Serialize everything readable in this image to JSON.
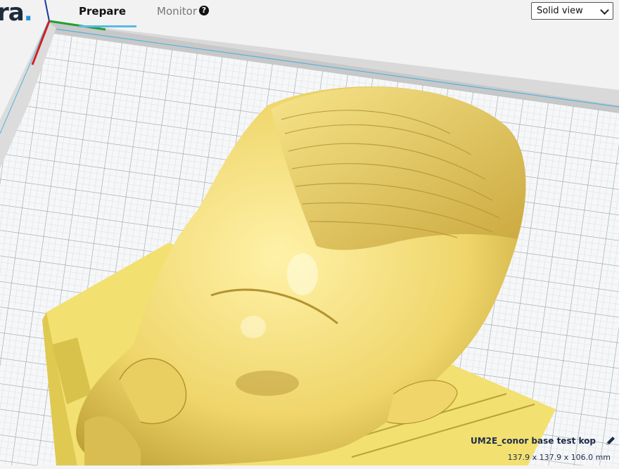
{
  "app": {
    "logo_text": "ra",
    "logo_dot": "."
  },
  "tabs": [
    {
      "label": "Prepare",
      "active": true
    },
    {
      "label": "Monitor",
      "active": false
    }
  ],
  "help_glyph": "?",
  "view_select": {
    "selected": "Solid view"
  },
  "job": {
    "name": "UM2E_conor base test kop",
    "dimensions": "137.9 x 137.9 x 106.0 mm"
  },
  "colors": {
    "model": "#f5e27a",
    "accent": "#2194d6",
    "grid_line": "#9aa1a8"
  }
}
